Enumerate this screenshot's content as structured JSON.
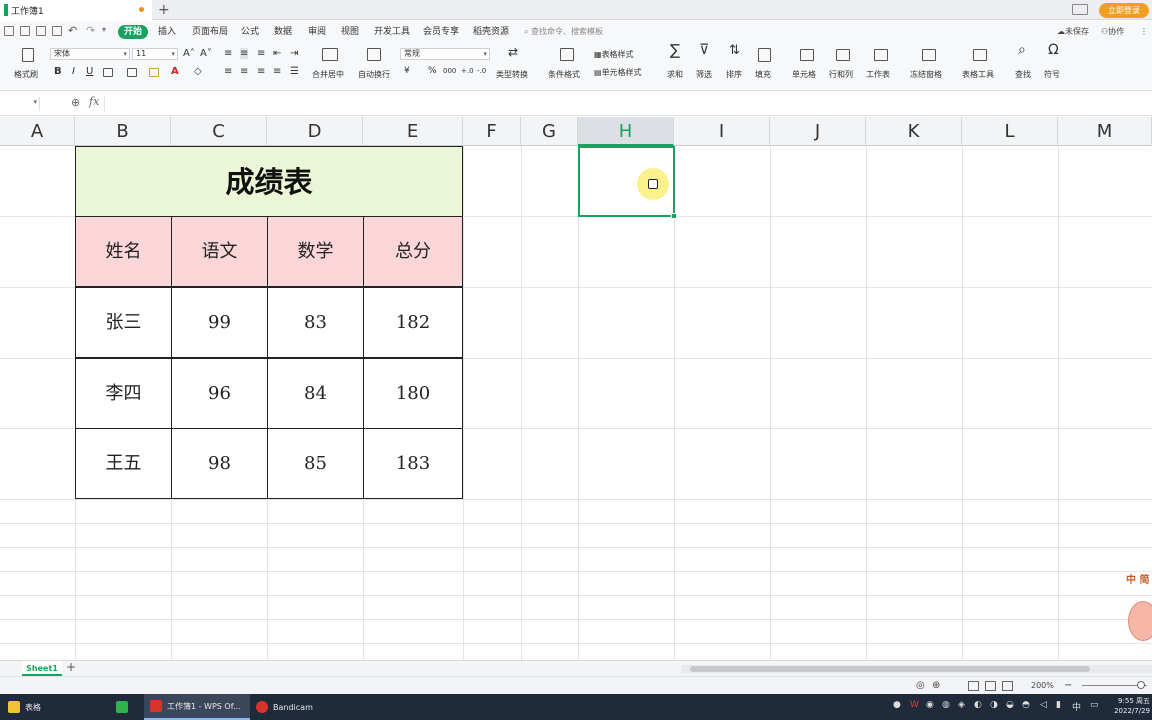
{
  "tabbar": {
    "doc_title": "工作簿1",
    "new_tab": "+",
    "login": "立即登录"
  },
  "menu": {
    "items": [
      "开始",
      "插入",
      "页面布局",
      "公式",
      "数据",
      "审阅",
      "视图",
      "开发工具",
      "会员专享",
      "稻壳资源"
    ],
    "search": "查找命令、搜索模板",
    "unsaved": "未保存",
    "collab": "协作"
  },
  "ribbon": {
    "format_painter": "格式刷",
    "font_name": "宋体",
    "font_size": "11",
    "number_format": "常规",
    "merge_center": "合并居中",
    "wrap": "自动换行",
    "type_convert": "类型转换",
    "conditional": "条件格式",
    "table_style": "表格样式",
    "cell_style": "单元格样式",
    "sum": "求和",
    "filter": "筛选",
    "sort": "排序",
    "fill": "填充",
    "cell": "单元格",
    "rowcol": "行和列",
    "worksheet": "工作表",
    "freeze": "冻结窗格",
    "table_tools": "表格工具",
    "find": "查找",
    "symbol": "符号",
    "currency": "¥",
    "percent": "%"
  },
  "formula_bar": {
    "fx": "fx",
    "value": ""
  },
  "columns": [
    "A",
    "B",
    "C",
    "D",
    "E",
    "F",
    "G",
    "H",
    "I",
    "J",
    "K",
    "L",
    "M"
  ],
  "selected_column": "H",
  "table": {
    "title": "成绩表",
    "headers": [
      "姓名",
      "语文",
      "数学",
      "总分"
    ],
    "rows": [
      [
        "张三",
        "99",
        "83",
        "182"
      ],
      [
        "李四",
        "96",
        "84",
        "180"
      ],
      [
        "王五",
        "98",
        "85",
        "183"
      ]
    ]
  },
  "sheets": {
    "active": "Sheet1",
    "add": "+"
  },
  "status": {
    "zoom": "200%"
  },
  "side": {
    "text": "中 简"
  },
  "taskbar": {
    "items": [
      {
        "label": "表格",
        "color": "#f2c230"
      },
      {
        "label": "",
        "color": "#2fb34a"
      },
      {
        "label": "工作簿1 - WPS Of...",
        "color": "#d9342b"
      },
      {
        "label": "Bandicam",
        "color": "#d9342b"
      }
    ],
    "ime": "中",
    "time": "9:55 周五",
    "date": "2022/7/29"
  },
  "colors": {
    "accent": "#1aa15f",
    "title_fill": "#ebf6d6",
    "header_fill": "#fbd6d8"
  }
}
